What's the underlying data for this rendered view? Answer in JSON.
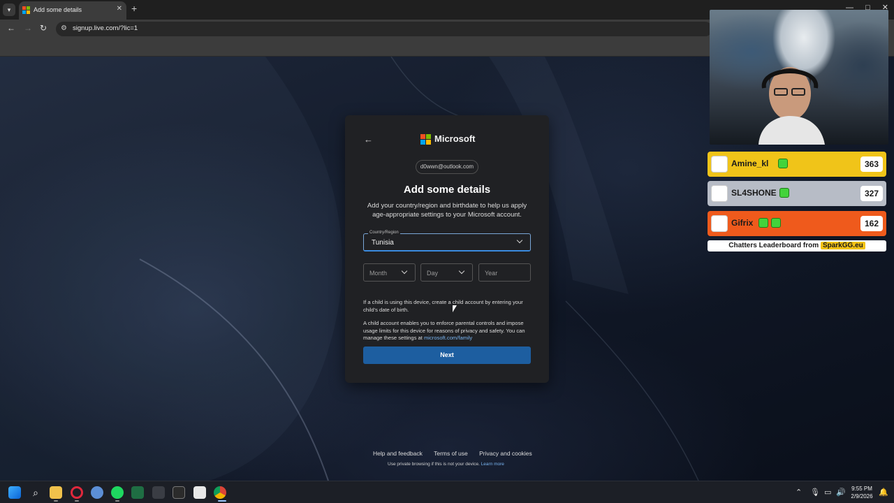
{
  "browser": {
    "tab_title": "Add some details",
    "new_tab_glyph": "+",
    "tab_close_glyph": "✕",
    "url": "signup.live.com/?lic=1"
  },
  "signup": {
    "back_icon": "back-arrow-icon",
    "brand": "Microsoft",
    "email": "d0wwn@outlook.com",
    "title": "Add some details",
    "description": "Add your country/region and birthdate to help us apply age-appropriate settings to your Microsoft account.",
    "country_label": "Country/Region",
    "country_value": "Tunisia",
    "month_placeholder": "Month",
    "day_placeholder": "Day",
    "year_placeholder": "Year",
    "child_note": "If a child is using this device, create a child account by entering your child's date of birth.",
    "parental_note": "A child account enables you to enforce parental controls and impose usage limits for this device for reasons of privacy and safety. You can manage these settings at",
    "family_link": "microsoft.com/family",
    "next_label": "Next"
  },
  "footer": {
    "help": "Help and feedback",
    "terms": "Terms of use",
    "privacy": "Privacy and cookies",
    "private_note": "Use private browsing if this is not your device.",
    "learn_more": "Learn more"
  },
  "leaderboard": {
    "rows": [
      {
        "name": "Amine_kl",
        "score": "363",
        "color": "#f0c419"
      },
      {
        "name": "SL4SHONE",
        "score": "327",
        "color": "#b7bcc6"
      },
      {
        "name": "Gifrix",
        "score": "162",
        "color": "#ef5a1c"
      }
    ],
    "footer_prefix": "Chatters Leaderboard from",
    "footer_brand": "SparkGG.eu"
  },
  "taskbar": {
    "time": "9:55 PM",
    "date": "2/9/2026"
  },
  "colors": {
    "ms_red": "#f25022",
    "ms_green": "#7fba00",
    "ms_blue": "#00a4ef",
    "ms_yellow": "#ffb900",
    "next_button": "#1d5ea0",
    "link": "#78b4f0"
  }
}
